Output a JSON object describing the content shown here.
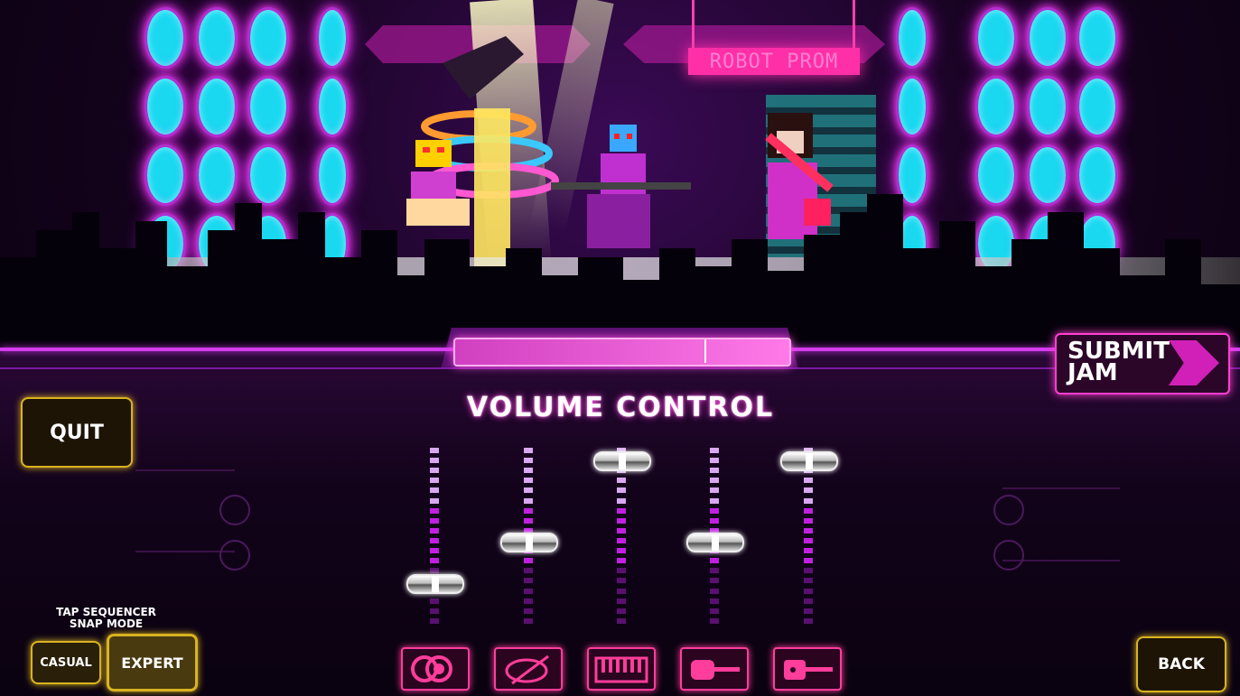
{
  "scene": {
    "sign_text": "ROBOT PROM"
  },
  "progress": {
    "fraction": 0.75
  },
  "panel": {
    "title": "VOLUME CONTROL"
  },
  "sliders": [
    {
      "name": "drums",
      "level": 0.22
    },
    {
      "name": "bass",
      "level": 0.48
    },
    {
      "name": "keys",
      "level": 0.98
    },
    {
      "name": "guitar",
      "level": 0.48
    },
    {
      "name": "lead",
      "level": 0.98
    }
  ],
  "instruments": [
    {
      "icon": "drum-icon"
    },
    {
      "icon": "turntable-icon"
    },
    {
      "icon": "keyboard-icon"
    },
    {
      "icon": "guitar-icon"
    },
    {
      "icon": "lead-guitar-icon"
    }
  ],
  "buttons": {
    "quit": "QUIT",
    "back": "BACK",
    "submit_line1": "SUBMIT",
    "submit_line2": "JAM",
    "snap_label_line1": "TAP SEQUENCER",
    "snap_label_line2": "SNAP MODE",
    "casual": "CASUAL",
    "expert": "EXPERT"
  },
  "colors": {
    "accent": "#ff3fd0",
    "speaker": "#1ad8f0",
    "gold": "#d9b321"
  }
}
